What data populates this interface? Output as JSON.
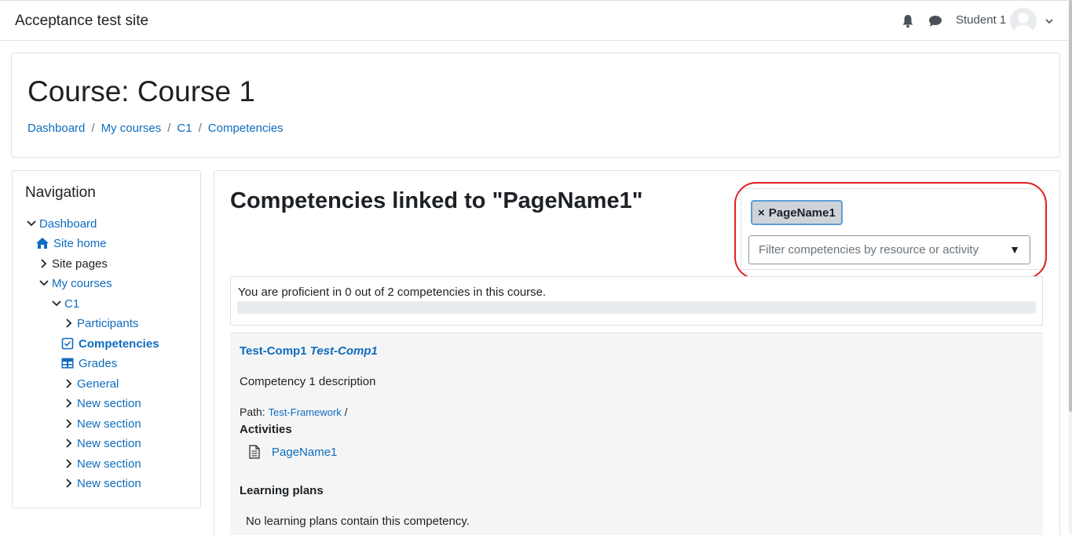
{
  "navbar": {
    "site_name": "Acceptance test site",
    "user_name": "Student 1",
    "icons": [
      "bell-icon",
      "chat-icon",
      "avatar",
      "chevron-down-icon"
    ]
  },
  "header": {
    "title": "Course: Course 1",
    "breadcrumb": [
      "Dashboard",
      "My courses",
      "C1",
      "Competencies"
    ],
    "separator": "/"
  },
  "navigation": {
    "title": "Navigation",
    "items": [
      {
        "label": "Dashboard",
        "icon": "chevron-down-icon",
        "link": true
      },
      {
        "label": "Site home",
        "icon": "home-icon",
        "link": true
      },
      {
        "label": "Site pages",
        "icon": "chevron-right-icon",
        "link": false
      },
      {
        "label": "My courses",
        "icon": "chevron-down-icon",
        "link": true
      },
      {
        "label": "C1",
        "icon": "chevron-down-icon",
        "link": true
      },
      {
        "label": "Participants",
        "icon": "chevron-right-icon",
        "link": true
      },
      {
        "label": "Competencies",
        "icon": "checkbox-icon",
        "link": true,
        "active": true
      },
      {
        "label": "Grades",
        "icon": "table-icon",
        "link": true
      },
      {
        "label": "General",
        "icon": "chevron-right-icon",
        "link": true
      },
      {
        "label": "New section",
        "icon": "chevron-right-icon",
        "link": true
      },
      {
        "label": "New section",
        "icon": "chevron-right-icon",
        "link": true
      },
      {
        "label": "New section",
        "icon": "chevron-right-icon",
        "link": true
      },
      {
        "label": "New section",
        "icon": "chevron-right-icon",
        "link": true
      },
      {
        "label": "New section",
        "icon": "chevron-right-icon",
        "link": true
      }
    ]
  },
  "main": {
    "heading": "Competencies linked to \"PageName1\"",
    "filter": {
      "selected_tag": "PageName1",
      "tag_remove": "×",
      "placeholder": "Filter competencies by resource or activity",
      "caret": "▼"
    },
    "progress": {
      "text": "You are proficient in 0 out of 2 competencies in this course.",
      "proficient": 0,
      "total": 2
    },
    "competency": {
      "shortname": "Test-Comp1",
      "idnumber": "Test-Comp1",
      "description": "Competency 1 description",
      "path_label": "Path:",
      "path_framework": "Test-Framework",
      "path_sep": "/",
      "activities_label": "Activities",
      "activity": "PageName1",
      "plans_label": "Learning plans",
      "no_plans": "No learning plans contain this competency."
    }
  },
  "colors": {
    "link": "#0f6cbf",
    "text": "#1d2125",
    "border": "#dee2e6",
    "highlight_oval": "#e02020",
    "panel_bg": "#f5f5f5"
  }
}
